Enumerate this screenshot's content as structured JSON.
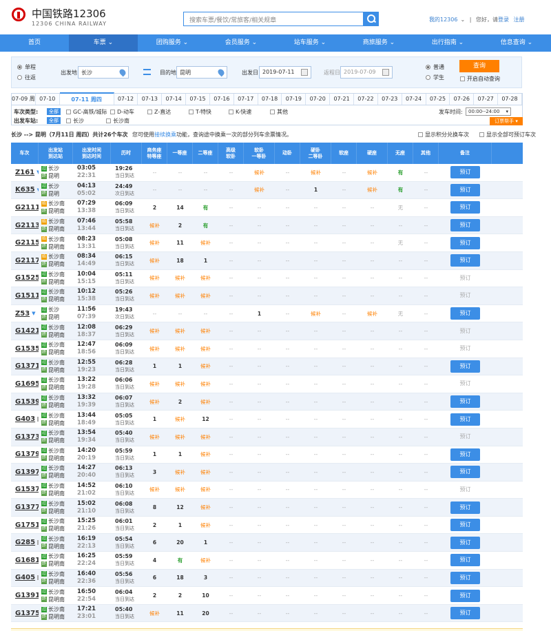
{
  "logo": {
    "cn": "中国铁路12306",
    "en": "12306 CHINA RAILWAY"
  },
  "search": {
    "placeholder": "搜索车票/餐饮/常旅客/相关规章"
  },
  "top_links": {
    "my": "我的12306",
    "greet": "您好，请",
    "login": "登录",
    "register": "注册"
  },
  "nav": [
    "首页",
    "车票",
    "团购服务",
    "会员服务",
    "站车服务",
    "商旅服务",
    "出行指南",
    "信息查询"
  ],
  "nav_dropdown_indices": [
    1,
    2,
    3,
    4,
    5,
    6,
    7
  ],
  "query": {
    "oneway": "单程",
    "roundtrip": "往返",
    "from_label": "出发地",
    "from_value": "长沙",
    "to_label": "目的地",
    "to_value": "昆明",
    "date_label": "出发日",
    "date_value": "2019-07-11",
    "return_label": "返程日",
    "return_value": "2019-07-09",
    "normal": "普通",
    "student": "学生",
    "search_btn": "查询",
    "auto_query": "开启自动查询"
  },
  "dates": [
    "07-09 周",
    "07-10",
    "07-11 周四",
    "07-12",
    "07-13",
    "07-14",
    "07-15",
    "07-16",
    "07-17",
    "07-18",
    "07-19",
    "07-20",
    "07-21",
    "07-22",
    "07-23",
    "07-24",
    "07-25",
    "07-26",
    "07-27",
    "07-28"
  ],
  "active_date_index": 2,
  "filter": {
    "type_label": "车次类型:",
    "all": "全部",
    "types": [
      "GC-高铁/城际",
      "D-动车",
      "Z-直达",
      "T-特快",
      "K-快速",
      "其他"
    ],
    "station_label": "出发车站:",
    "stations": [
      "长沙",
      "长沙南"
    ],
    "time_label": "发车时间:",
    "time_value": "00:00--24:00",
    "help_btn": "订票帮手"
  },
  "summary": {
    "route": "长沙 --> 昆明（7月11日 周四）共计",
    "count": "26",
    "route_tail": "个车次",
    "hint_pre": "您可使用",
    "hint_link": "接续换乘",
    "hint_post": "功能，查询途中换乘一次的部分列车余票情况。",
    "opt1": "显示积分兑换车次",
    "opt2": "显示全部可预订车次"
  },
  "columns": [
    "车次",
    "出发站\n到达站",
    "出发时间\n到达时间",
    "历时",
    "商务座\n特等座",
    "一等座",
    "二等座",
    "高级\n软卧",
    "软卧\n一等卧",
    "动卧",
    "硬卧\n二等卧",
    "软座",
    "硬座",
    "无座",
    "其他",
    "备注"
  ],
  "book_label": "预订",
  "trains": [
    {
      "no": "Z161",
      "from": "长沙",
      "to": "昆明",
      "fs": "p",
      "ts": "e",
      "dep": "03:05",
      "arr": "22:31",
      "dur": "19:26",
      "day": "当日到达",
      "seats": [
        "--",
        "--",
        "--",
        "--",
        "候补",
        "--",
        "候补",
        "--",
        "候补",
        "有",
        "--"
      ],
      "book": true,
      "ticket": false
    },
    {
      "no": "K635",
      "from": "长沙",
      "to": "昆明",
      "fs": "p",
      "ts": "e",
      "dep": "04:13",
      "arr": "05:02",
      "dur": "24:49",
      "day": "次日到达",
      "seats": [
        "--",
        "--",
        "--",
        "--",
        "候补",
        "--",
        "1",
        "--",
        "候补",
        "有",
        "--"
      ],
      "book": true,
      "ticket": false
    },
    {
      "no": "G2111",
      "from": "长沙南",
      "to": "昆明南",
      "fs": "s",
      "ts": "e",
      "dep": "07:29",
      "arr": "13:38",
      "dur": "06:09",
      "day": "当日到达",
      "seats": [
        "2",
        "14",
        "有",
        "--",
        "--",
        "--",
        "--",
        "--",
        "--",
        "无",
        "--"
      ],
      "book": true,
      "ticket": true
    },
    {
      "no": "G2113",
      "from": "长沙南",
      "to": "昆明南",
      "fs": "s",
      "ts": "e",
      "dep": "07:46",
      "arr": "13:44",
      "dur": "05:58",
      "day": "当日到达",
      "seats": [
        "候补",
        "2",
        "有",
        "--",
        "--",
        "--",
        "--",
        "--",
        "--",
        "--",
        "--"
      ],
      "book": true,
      "ticket": true
    },
    {
      "no": "G2115",
      "from": "长沙南",
      "to": "昆明南",
      "fs": "s",
      "ts": "e",
      "dep": "08:23",
      "arr": "13:31",
      "dur": "05:08",
      "day": "当日到达",
      "seats": [
        "候补",
        "11",
        "候补",
        "--",
        "--",
        "--",
        "--",
        "--",
        "--",
        "无",
        "--"
      ],
      "book": true,
      "ticket": true
    },
    {
      "no": "G2117",
      "from": "长沙南",
      "to": "昆明南",
      "fs": "s",
      "ts": "e",
      "dep": "08:34",
      "arr": "14:49",
      "dur": "06:15",
      "day": "当日到达",
      "seats": [
        "候补",
        "18",
        "1",
        "--",
        "--",
        "--",
        "--",
        "--",
        "--",
        "--",
        "--"
      ],
      "book": true,
      "ticket": true
    },
    {
      "no": "G1525",
      "from": "长沙南",
      "to": "昆明南",
      "fs": "p",
      "ts": "e",
      "dep": "10:04",
      "arr": "15:15",
      "dur": "05:11",
      "day": "当日到达",
      "seats": [
        "候补",
        "候补",
        "候补",
        "--",
        "--",
        "--",
        "--",
        "--",
        "--",
        "--",
        "--"
      ],
      "book": false,
      "ticket": true
    },
    {
      "no": "G1511",
      "from": "长沙南",
      "to": "昆明南",
      "fs": "p",
      "ts": "e",
      "dep": "10:12",
      "arr": "15:38",
      "dur": "05:26",
      "day": "当日到达",
      "seats": [
        "候补",
        "候补",
        "候补",
        "--",
        "--",
        "--",
        "--",
        "--",
        "--",
        "--",
        "--"
      ],
      "book": false,
      "ticket": true
    },
    {
      "no": "Z53",
      "from": "长沙",
      "to": "昆明",
      "fs": "p",
      "ts": "e",
      "dep": "11:56",
      "arr": "07:39",
      "dur": "19:43",
      "day": "次日到达",
      "seats": [
        "--",
        "--",
        "--",
        "--",
        "1",
        "--",
        "候补",
        "--",
        "候补",
        "无",
        "--"
      ],
      "book": true,
      "ticket": false
    },
    {
      "no": "G1421",
      "from": "长沙南",
      "to": "昆明南",
      "fs": "p",
      "ts": "e",
      "dep": "12:08",
      "arr": "18:37",
      "dur": "06:29",
      "day": "当日到达",
      "seats": [
        "候补",
        "候补",
        "候补",
        "--",
        "--",
        "--",
        "--",
        "--",
        "--",
        "--",
        "--"
      ],
      "book": false,
      "ticket": true
    },
    {
      "no": "G1535",
      "from": "长沙南",
      "to": "昆明南",
      "fs": "p",
      "ts": "e",
      "dep": "12:47",
      "arr": "18:56",
      "dur": "06:09",
      "day": "当日到达",
      "seats": [
        "候补",
        "候补",
        "候补",
        "--",
        "--",
        "--",
        "--",
        "--",
        "--",
        "--",
        "--"
      ],
      "book": false,
      "ticket": true
    },
    {
      "no": "G1371",
      "from": "长沙南",
      "to": "昆明南",
      "fs": "p",
      "ts": "e",
      "dep": "12:55",
      "arr": "19:23",
      "dur": "06:28",
      "day": "当日到达",
      "seats": [
        "1",
        "1",
        "候补",
        "--",
        "--",
        "--",
        "--",
        "--",
        "--",
        "--",
        "--"
      ],
      "book": true,
      "ticket": true
    },
    {
      "no": "G1695",
      "from": "长沙南",
      "to": "昆明南",
      "fs": "p",
      "ts": "e",
      "dep": "13:22",
      "arr": "19:28",
      "dur": "06:06",
      "day": "当日到达",
      "seats": [
        "候补",
        "候补",
        "候补",
        "--",
        "--",
        "--",
        "--",
        "--",
        "--",
        "--",
        "--"
      ],
      "book": false,
      "ticket": true
    },
    {
      "no": "G1539",
      "from": "长沙南",
      "to": "昆明南",
      "fs": "p",
      "ts": "e",
      "dep": "13:32",
      "arr": "19:39",
      "dur": "06:07",
      "day": "当日到达",
      "seats": [
        "候补",
        "2",
        "候补",
        "--",
        "--",
        "--",
        "--",
        "--",
        "--",
        "--",
        "--"
      ],
      "book": true,
      "ticket": true
    },
    {
      "no": "G403",
      "from": "长沙南",
      "to": "昆明南",
      "fs": "p",
      "ts": "e",
      "dep": "13:44",
      "arr": "18:49",
      "dur": "05:05",
      "day": "当日到达",
      "seats": [
        "1",
        "候补",
        "12",
        "--",
        "--",
        "--",
        "--",
        "--",
        "--",
        "--",
        "--"
      ],
      "book": true,
      "ticket": true
    },
    {
      "no": "G1373",
      "from": "长沙南",
      "to": "昆明南",
      "fs": "p",
      "ts": "e",
      "dep": "13:54",
      "arr": "19:34",
      "dur": "05:40",
      "day": "当日到达",
      "seats": [
        "候补",
        "候补",
        "候补",
        "--",
        "--",
        "--",
        "--",
        "--",
        "--",
        "--",
        "--"
      ],
      "book": false,
      "ticket": true
    },
    {
      "no": "G1379",
      "from": "长沙南",
      "to": "昆明南",
      "fs": "p",
      "ts": "e",
      "dep": "14:20",
      "arr": "20:19",
      "dur": "05:59",
      "day": "当日到达",
      "seats": [
        "1",
        "1",
        "候补",
        "--",
        "--",
        "--",
        "--",
        "--",
        "--",
        "--",
        "--"
      ],
      "book": true,
      "ticket": true
    },
    {
      "no": "G1397",
      "from": "长沙南",
      "to": "昆明南",
      "fs": "p",
      "ts": "e",
      "dep": "14:27",
      "arr": "20:40",
      "dur": "06:13",
      "day": "当日到达",
      "seats": [
        "3",
        "候补",
        "候补",
        "--",
        "--",
        "--",
        "--",
        "--",
        "--",
        "--",
        "--"
      ],
      "book": true,
      "ticket": true
    },
    {
      "no": "G1537",
      "from": "长沙南",
      "to": "昆明南",
      "fs": "p",
      "ts": "e",
      "dep": "14:52",
      "arr": "21:02",
      "dur": "06:10",
      "day": "当日到达",
      "seats": [
        "候补",
        "候补",
        "候补",
        "--",
        "--",
        "--",
        "--",
        "--",
        "--",
        "--",
        "--"
      ],
      "book": false,
      "ticket": true
    },
    {
      "no": "G1377",
      "from": "长沙南",
      "to": "昆明南",
      "fs": "p",
      "ts": "e",
      "dep": "15:02",
      "arr": "21:10",
      "dur": "06:08",
      "day": "当日到达",
      "seats": [
        "8",
        "12",
        "候补",
        "--",
        "--",
        "--",
        "--",
        "--",
        "--",
        "--",
        "--"
      ],
      "book": true,
      "ticket": true
    },
    {
      "no": "G1751",
      "from": "长沙南",
      "to": "昆明南",
      "fs": "p",
      "ts": "e",
      "dep": "15:25",
      "arr": "21:26",
      "dur": "06:01",
      "day": "当日到达",
      "seats": [
        "2",
        "1",
        "候补",
        "--",
        "--",
        "--",
        "--",
        "--",
        "--",
        "--",
        "--"
      ],
      "book": true,
      "ticket": true
    },
    {
      "no": "G285",
      "from": "长沙南",
      "to": "昆明南",
      "fs": "p",
      "ts": "e",
      "dep": "16:19",
      "arr": "22:13",
      "dur": "05:54",
      "day": "当日到达",
      "seats": [
        "6",
        "20",
        "1",
        "--",
        "--",
        "--",
        "--",
        "--",
        "--",
        "--",
        "--"
      ],
      "book": true,
      "ticket": true
    },
    {
      "no": "G1681",
      "from": "长沙南",
      "to": "昆明南",
      "fs": "p",
      "ts": "e",
      "dep": "16:25",
      "arr": "22:24",
      "dur": "05:59",
      "day": "当日到达",
      "seats": [
        "4",
        "有",
        "候补",
        "--",
        "--",
        "--",
        "--",
        "--",
        "--",
        "--",
        "--"
      ],
      "book": true,
      "ticket": true
    },
    {
      "no": "G405",
      "from": "长沙南",
      "to": "昆明南",
      "fs": "p",
      "ts": "e",
      "dep": "16:40",
      "arr": "22:36",
      "dur": "05:56",
      "day": "当日到达",
      "seats": [
        "6",
        "18",
        "3",
        "--",
        "--",
        "--",
        "--",
        "--",
        "--",
        "--",
        "--"
      ],
      "book": true,
      "ticket": true
    },
    {
      "no": "G1391",
      "from": "长沙南",
      "to": "昆明南",
      "fs": "p",
      "ts": "e",
      "dep": "16:50",
      "arr": "22:54",
      "dur": "06:04",
      "day": "当日到达",
      "seats": [
        "2",
        "2",
        "10",
        "--",
        "--",
        "--",
        "--",
        "--",
        "--",
        "--",
        "--"
      ],
      "book": true,
      "ticket": true
    },
    {
      "no": "G1375",
      "from": "长沙南",
      "to": "昆明南",
      "fs": "p",
      "ts": "e",
      "dep": "17:21",
      "arr": "23:01",
      "dur": "05:40",
      "day": "当日到达",
      "seats": [
        "候补",
        "11",
        "20",
        "--",
        "--",
        "--",
        "--",
        "--",
        "--",
        "--",
        "--"
      ],
      "book": true,
      "ticket": true
    }
  ],
  "colors": {
    "primary": "#3c8ee6",
    "accent": "#ff8000",
    "available": "#2ea032"
  }
}
